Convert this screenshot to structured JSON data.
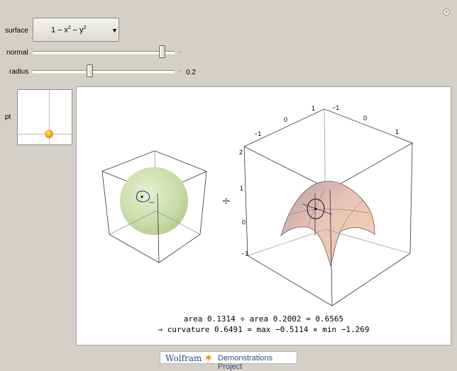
{
  "controls": {
    "surface_label": "surface",
    "surface_value": "1 – x",
    "surface_value_y": " – y",
    "surface_sup1": "2",
    "surface_sup2": "2",
    "normal_label": "normal",
    "normal_level": 0.93,
    "radius_label": "radius",
    "radius_level": 0.4,
    "radius_value": "0.2",
    "pt_label": "pt"
  },
  "graphics": {
    "divide_symbol": "÷",
    "axis_x_ticks": [
      "−1",
      "0",
      "1"
    ],
    "axis_y_ticks": [
      "1",
      "−1",
      "0",
      "1"
    ],
    "axis_z_ticks": [
      "2",
      "1",
      "0",
      "−1"
    ]
  },
  "formula": {
    "line1": "area 0.1314 ÷ area 0.2002 = 0.6565",
    "line2": "→ curvature 0.6491 = max −0.5114 × min −1.269"
  },
  "footer": {
    "wolfram": "Wolfram",
    "demonstrations": "Demonstrations Project"
  },
  "icons": {
    "corner_plus": "+",
    "slider_plus": "+",
    "dropdown_arrow": "▼",
    "star": "✶"
  }
}
